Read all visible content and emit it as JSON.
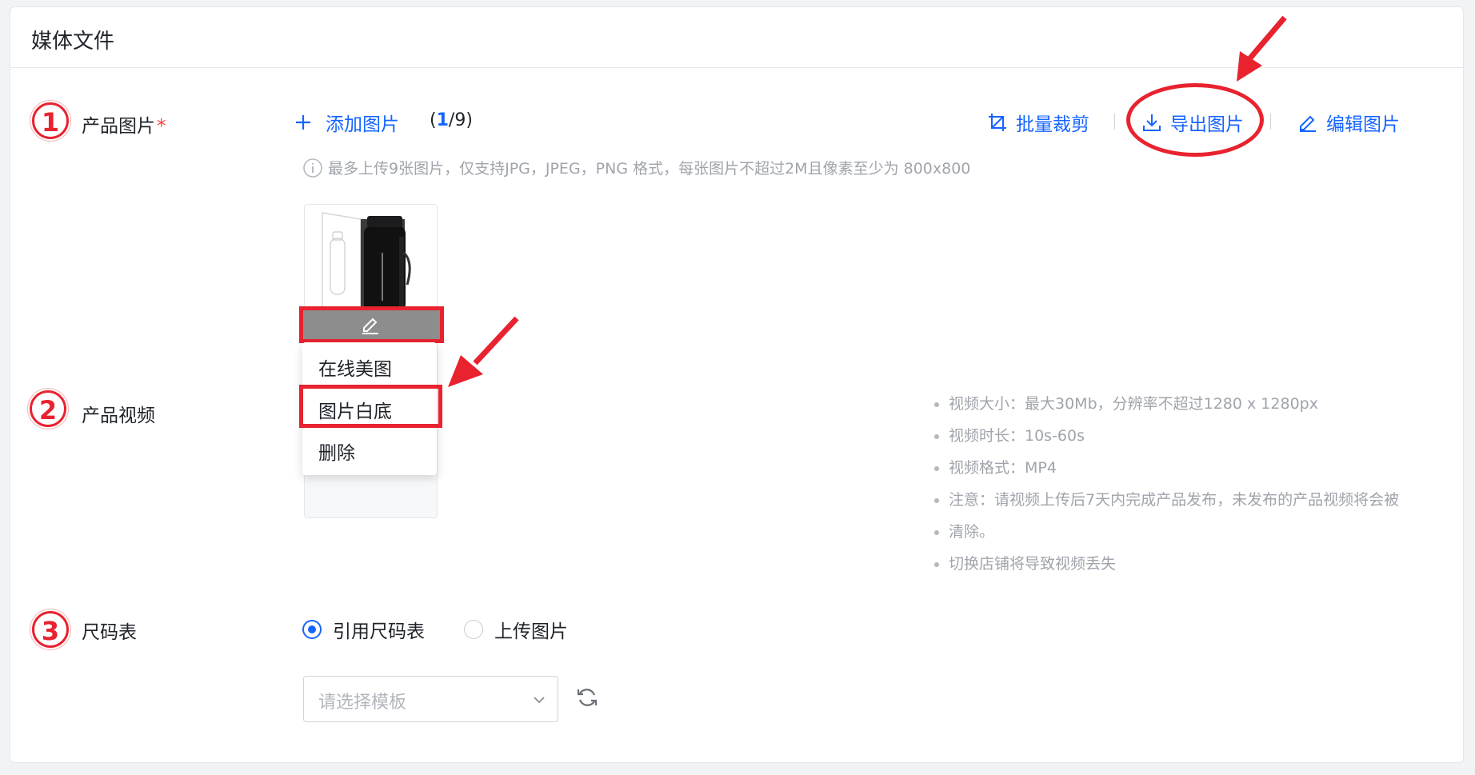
{
  "section": {
    "title": "媒体文件"
  },
  "steps": [
    "1",
    "2",
    "3"
  ],
  "product_images": {
    "label": "产品图片",
    "required_mark": "*",
    "add_label": "添加图片",
    "count_current": "1",
    "count_total": "/9)",
    "count_open": "(",
    "batch_crop_label": "批量裁剪",
    "export_label": "导出图片",
    "edit_label": "编辑图片",
    "hint": "最多上传9张图片，仅支持JPG，JPEG，PNG 格式，每张图片不超过2M且像素至少为 800x800",
    "menu": [
      "在线美图",
      "图片白底",
      "删除"
    ]
  },
  "product_video": {
    "label": "产品视频",
    "notes": [
      "视频大小：最大30Mb，分辨率不超过1280 x 1280px",
      "视频时长：10s-60s",
      "视频格式：MP4",
      "注意：请视频上传后7天内完成产品发布，未发布的产品视频将会被",
      "清除。",
      "切换店铺将导致视频丢失"
    ]
  },
  "size_chart": {
    "label": "尺码表",
    "options": [
      "引用尺码表",
      "上传图片"
    ],
    "selected": "引用尺码表",
    "template_placeholder": "请选择模板"
  },
  "colors": {
    "accent": "#1664ff",
    "annotation_red": "#e8232f",
    "hint_gray": "#a0a4ab"
  }
}
